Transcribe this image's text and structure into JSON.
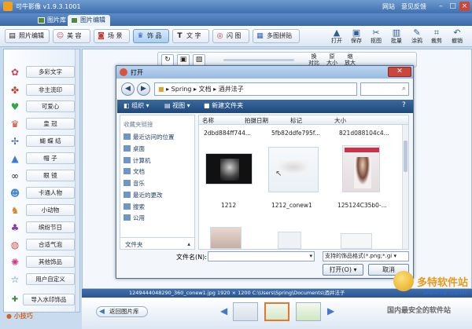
{
  "app": {
    "title": "可牛影像 v1.9.3.1001",
    "links": [
      "网站",
      "意见反馈"
    ],
    "tabs": [
      {
        "label": "图片库",
        "active": false
      },
      {
        "label": "图片编辑",
        "active": true
      }
    ]
  },
  "toolbar": {
    "left_buttons": [
      {
        "label": "照片编辑",
        "icon": "photo-edit-icon",
        "glyph": "▤"
      },
      {
        "label": "美 容",
        "icon": "beauty-face-icon",
        "glyph": "☺"
      },
      {
        "label": "场 景",
        "icon": "scene-icon",
        "glyph": "◙"
      },
      {
        "label": "饰 品",
        "icon": "accessory-icon",
        "glyph": "♛",
        "active": true
      },
      {
        "label": "文 字",
        "icon": "text-icon",
        "glyph": "T"
      },
      {
        "label": "闪 图",
        "icon": "flash-image-icon",
        "glyph": "◎"
      },
      {
        "label": "多图拼贴",
        "icon": "collage-icon",
        "glyph": "▦"
      }
    ],
    "right_buttons": [
      {
        "label": "打开",
        "icon": "open-folder-icon",
        "glyph": "▲"
      },
      {
        "label": "保存",
        "icon": "save-icon",
        "glyph": "▣"
      },
      {
        "label": "抠图",
        "icon": "cutout-icon",
        "glyph": "✂"
      },
      {
        "label": "批量",
        "icon": "batch-icon",
        "glyph": "▥"
      },
      {
        "label": "涂鸦",
        "icon": "doodle-icon",
        "glyph": "✎"
      },
      {
        "label": "裁剪",
        "icon": "crop-icon",
        "glyph": "⌗"
      },
      {
        "label": "撤销",
        "icon": "undo-icon",
        "glyph": "↶"
      }
    ]
  },
  "sidebar": {
    "items": [
      {
        "label": "多彩文字",
        "icon": "colorful-text-icon",
        "glyph": "✿",
        "color": "#d0445a"
      },
      {
        "label": "非主流印",
        "icon": "stamp-icon",
        "glyph": "✤",
        "color": "#c43f2a"
      },
      {
        "label": "可爱心",
        "icon": "heart-icon",
        "glyph": "♥",
        "color": "#3aa34a"
      },
      {
        "label": "皇 冠",
        "icon": "crown-icon",
        "glyph": "♛",
        "color": "#d0442a"
      },
      {
        "label": "蝴 蝶 结",
        "icon": "bow-icon",
        "glyph": "✢",
        "color": "#2e5fb8"
      },
      {
        "label": "帽 子",
        "icon": "hat-icon",
        "glyph": "▲",
        "color": "#3a7bd0"
      },
      {
        "label": "眼 镜",
        "icon": "glasses-icon",
        "glyph": "∞",
        "color": "#222222"
      },
      {
        "label": "卡通人物",
        "icon": "cartoon-icon",
        "glyph": "☻",
        "color": "#4a8ad0"
      },
      {
        "label": "小动物",
        "icon": "animal-icon",
        "glyph": "♞",
        "color": "#d08a2a"
      },
      {
        "label": "缤纷节日",
        "icon": "festival-icon",
        "glyph": "♣",
        "color": "#8a3ab0"
      },
      {
        "label": "合适气泡",
        "icon": "bubble-icon",
        "glyph": "◍",
        "color": "#d04a4a"
      },
      {
        "label": "其他饰品",
        "icon": "other-icon",
        "glyph": "✺",
        "color": "#d03a8a"
      },
      {
        "label": "用户自定义",
        "icon": "star-icon",
        "glyph": "☆",
        "color": "#2e6fd0"
      }
    ],
    "import_button": "导入水印饰品",
    "tips": "小技巧"
  },
  "canvas_tools": {
    "left": [
      "↻",
      "▣",
      "▧"
    ],
    "right": [
      {
        "label": "换",
        "sub": "对比"
      },
      {
        "label": "原",
        "sub": "大小"
      },
      {
        "label": "缩",
        "sub": "放大"
      }
    ]
  },
  "dialog": {
    "title": "打开",
    "path": [
      "Spring",
      "文档",
      "酒井法子"
    ],
    "toolbar": [
      "组织 ▾",
      "视图 ▾",
      "新建文件夹"
    ],
    "nav_header": "收藏夹链接",
    "nav_items": [
      {
        "label": "最近访问的位置",
        "icon": "recent-places-icon"
      },
      {
        "label": "桌面",
        "icon": "desktop-icon"
      },
      {
        "label": "计算机",
        "icon": "computer-icon"
      },
      {
        "label": "文档",
        "icon": "documents-icon"
      },
      {
        "label": "音乐",
        "icon": "music-icon"
      },
      {
        "label": "最近的更改",
        "icon": "recent-changes-icon"
      },
      {
        "label": "搜索",
        "icon": "search-folder-icon"
      },
      {
        "label": "公用",
        "icon": "public-icon"
      }
    ],
    "folders_label": "文件夹",
    "columns": [
      "名称",
      "拍摄日期",
      "标记",
      "大小"
    ],
    "top_files": [
      "2dbd884ff744...",
      "5fb82ddfe795f...",
      "821d088104c4..."
    ],
    "files": [
      {
        "name": "1212",
        "kind": "dark"
      },
      {
        "name": "1212_conew1",
        "kind": "light"
      },
      {
        "name": "125124C35b0-...",
        "kind": "magazine"
      }
    ],
    "filename_label": "文件名(N):",
    "filename_value": "",
    "filter_value": "支持的饰品格式(*.png;*.gi ▾",
    "open_button": "打开(O) ▾",
    "cancel_button": "取消"
  },
  "status": {
    "text": "1249444048290_360_conew1.jpg    1920 × 1200    C:\\Users\\Spring\\Documents\\酒井法子"
  },
  "filmstrip": {
    "back_button": "返回图片库"
  },
  "watermark": {
    "line1": "多特软件站",
    "line2": "DuoTe.com",
    "line3": "国内最安全的软件站"
  }
}
